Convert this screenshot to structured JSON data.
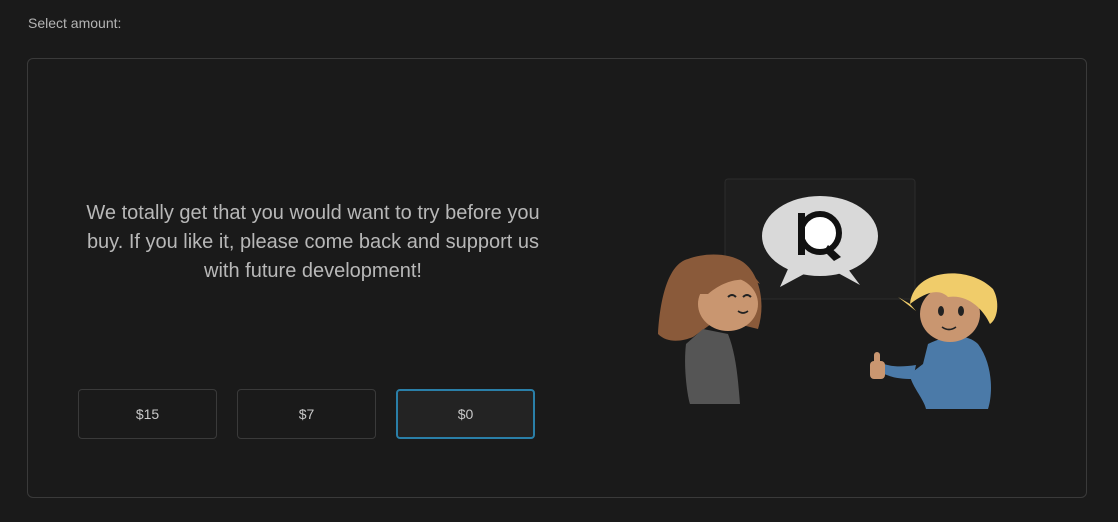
{
  "header": {
    "select_label": "Select amount:"
  },
  "card": {
    "message": "We totally get that you would want to try before you buy. If you like it, please come back and support us with future development!"
  },
  "amounts": [
    {
      "label": "$15",
      "selected": false
    },
    {
      "label": "$7",
      "selected": false
    },
    {
      "label": "$0",
      "selected": true
    }
  ],
  "colors": {
    "background": "#1a1a1a",
    "border": "#3a3a3a",
    "selected_border": "#2a7fa8",
    "text": "#b8b8b8"
  },
  "illustration": {
    "icons": [
      "speech-bubble-icon",
      "logo-p-icon",
      "thumbs-up-icon"
    ]
  }
}
